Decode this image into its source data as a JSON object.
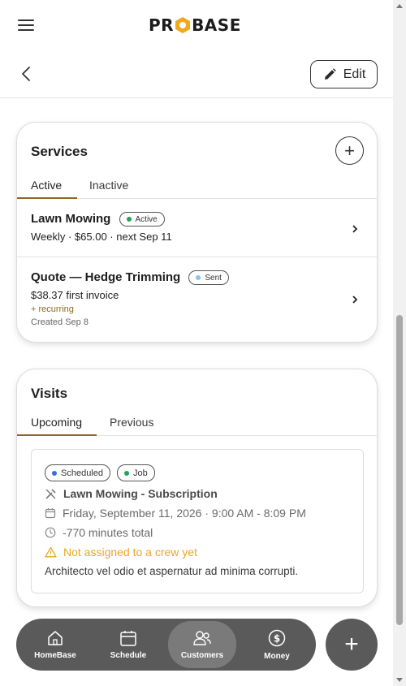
{
  "app": {
    "logo_text_a": "PR",
    "logo_text_b": "BASE",
    "edit_label": "Edit"
  },
  "services": {
    "title": "Services",
    "tabs": [
      {
        "label": "Active",
        "active": true
      },
      {
        "label": "Inactive",
        "active": false
      }
    ],
    "items": [
      {
        "name": "Lawn Mowing",
        "badge": "Active",
        "badge_color": "#22a552",
        "line": "Weekly · $65.00 · next Sep 11"
      },
      {
        "name": "Quote — Hedge Trimming",
        "badge": "Sent",
        "badge_color": "#8ec1ee",
        "line": "$38.37 first invoice",
        "extra": "+ recurring",
        "extra_color": "#8a6a20",
        "created": "Created Sep 8"
      }
    ]
  },
  "visits": {
    "title": "Visits",
    "tabs": [
      {
        "label": "Upcoming",
        "active": true
      },
      {
        "label": "Previous",
        "active": false
      }
    ],
    "visit": {
      "badges": [
        {
          "label": "Scheduled",
          "color": "#3b6fd6"
        },
        {
          "label": "Job",
          "color": "#22a552"
        }
      ],
      "title": "Lawn Mowing - Subscription",
      "date": "Friday, September 11, 2026 · 9:00 AM - 8:09 PM",
      "duration": "-770 minutes total",
      "warning": "Not assigned to a crew yet",
      "warning_color": "#e9a723",
      "note": "Architecto vel odio et aspernatur ad minima corrupti."
    }
  },
  "nav": {
    "items": [
      {
        "label": "HomeBase",
        "icon": "home-icon"
      },
      {
        "label": "Schedule",
        "icon": "calendar-icon"
      },
      {
        "label": "Customers",
        "icon": "users-icon",
        "active": true
      },
      {
        "label": "Money",
        "icon": "dollar-icon"
      }
    ],
    "fab_label": "+"
  },
  "colors": {
    "accent": "#8a6a20",
    "nav_bg": "#5a5a5a",
    "logo_hex": "#f2a81d"
  }
}
